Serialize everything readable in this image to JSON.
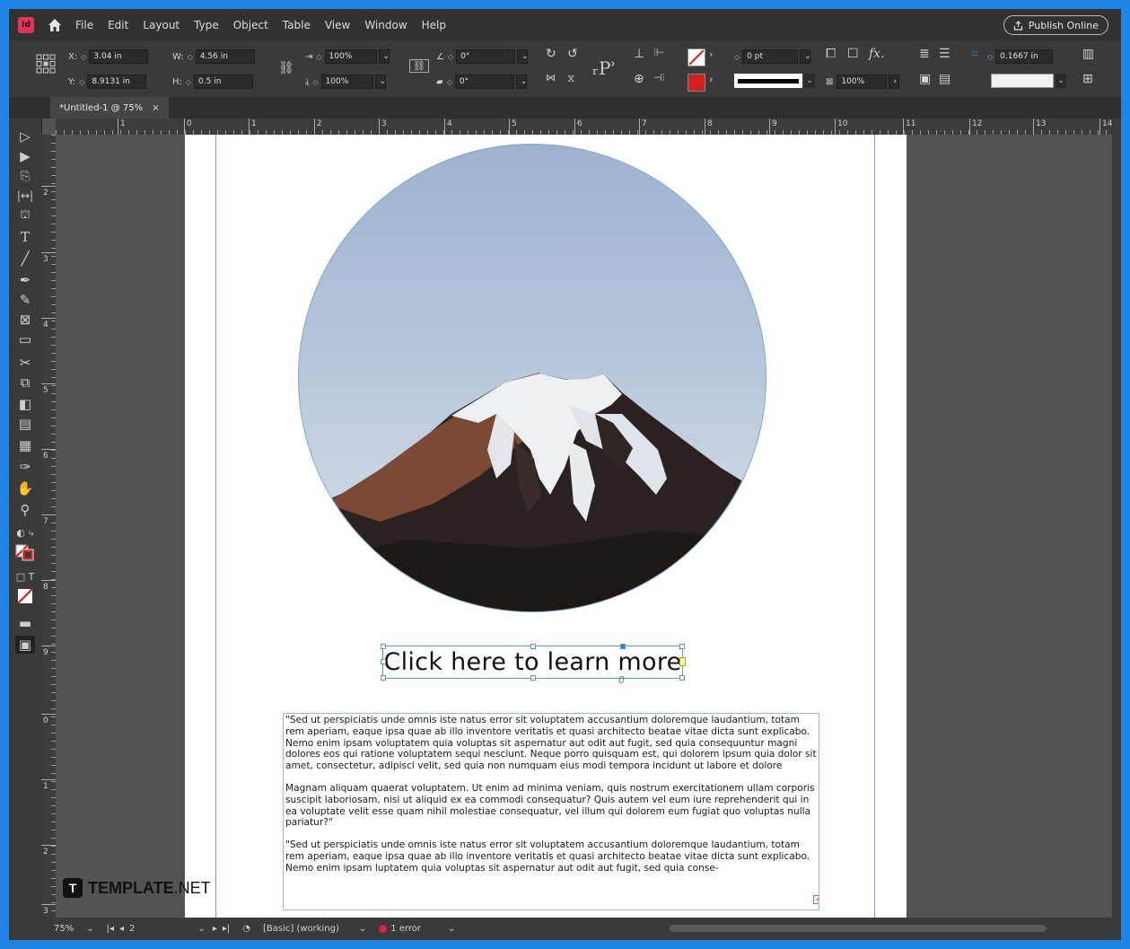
{
  "menubar": {
    "app_icon": "Id",
    "items": [
      "File",
      "Edit",
      "Layout",
      "Type",
      "Object",
      "Table",
      "View",
      "Window",
      "Help"
    ],
    "publish_label": "Publish Online"
  },
  "control_panel": {
    "x_label": "X:",
    "x_value": "3.04 in",
    "y_label": "Y:",
    "y_value": "8.9131 in",
    "w_label": "W:",
    "w_value": "4.56 in",
    "h_label": "H:",
    "h_value": "0.5 in",
    "scale_x": "100%",
    "scale_y": "100%",
    "rotate": "0°",
    "shear": "0°",
    "stroke_weight": "0 pt",
    "opacity": "100%",
    "inset": "0.1667 in"
  },
  "tab": {
    "title": "*Untitled-1 @ 75%",
    "close": "×"
  },
  "ruler_top": [
    "1",
    "0",
    "1",
    "2",
    "3",
    "4",
    "5",
    "6",
    "7",
    "8",
    "9",
    "10",
    "11",
    "12",
    "13",
    "14"
  ],
  "ruler_left": [
    "2",
    "3",
    "4",
    "5",
    "6",
    "7",
    "8",
    "9",
    "0",
    "1",
    "2",
    "3"
  ],
  "page": {
    "button_text": "Click here to learn more",
    "paragraphs": [
      "\"Sed ut perspiciatis unde omnis iste natus error sit voluptatem accusantium doloremque laudantium, totam rem aperiam, eaque ipsa quae ab illo inventore veritatis et quasi architecto beatae vitae dicta sunt explicabo. Nemo enim ipsam voluptatem quia voluptas sit aspernatur aut odit aut fugit, sed quia consequuntur magni dolores eos qui ratione voluptatem sequi nesciunt. Neque porro quisquam est, qui dolorem ipsum quia dolor sit amet, consectetur, adipisci velit, sed quia non numquam eius modi tempora incidunt ut labore et dolore",
      "Magnam aliquam quaerat voluptatem. Ut enim ad minima veniam, quis nostrum exercitationem ullam corporis suscipit laboriosam, nisi ut aliquid ex ea commodi consequatur? Quis autem vel eum iure reprehenderit qui in ea voluptate velit esse quam nihil molestiae consequatur, vel illum qui dolorem eum fugiat quo voluptas nulla pariatur?\"",
      "\"Sed ut perspiciatis unde omnis iste natus error sit voluptatem accusantium doloremque laudantium, totam rem aperiam, eaque ipsa quae ab illo inventore veritatis et quasi architecto beatae vitae dicta sunt explicabo. Nemo enim ipsam luptatem quia voluptas sit aspernatur aut odit aut fugit, sed quia conse-"
    ]
  },
  "watermark": {
    "mark": "T",
    "brand": "TEMPLATE",
    "suffix": ".NET"
  },
  "statusbar": {
    "zoom": "75%",
    "page": "2",
    "style": "[Basic] (working)",
    "errors": "1 error"
  },
  "colors": {
    "accent": "#1f86e6",
    "selection": "#5e94d8",
    "margin_guide": "#c07ae0",
    "error": "#e0203a"
  }
}
